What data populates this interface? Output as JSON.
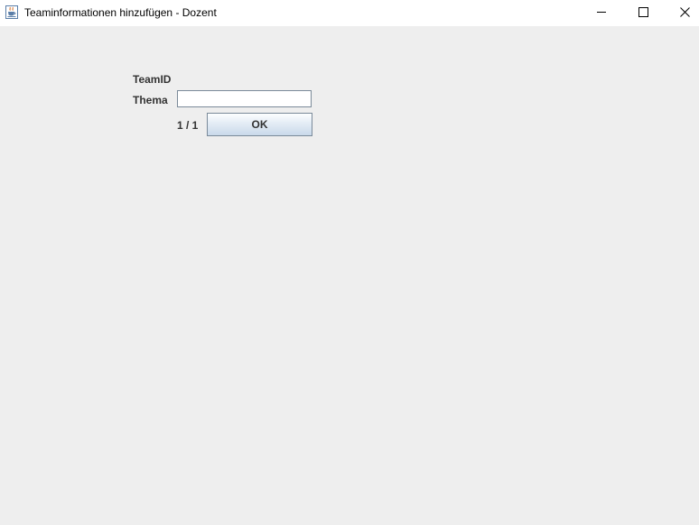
{
  "window": {
    "title": "Teaminformationen hinzufügen - Dozent",
    "icon": "java-cup-icon",
    "controls": [
      "minimize-icon",
      "maximize-icon",
      "close-icon"
    ]
  },
  "form": {
    "teamid_label": "TeamID",
    "thema_label": "Thema",
    "thema_value": "",
    "counter": "1 / 1",
    "ok_label": "OK"
  },
  "colors": {
    "background": "#eeeeee",
    "titlebar": "#ffffff",
    "label_text": "#333333",
    "button_border": "#7a8a99"
  }
}
